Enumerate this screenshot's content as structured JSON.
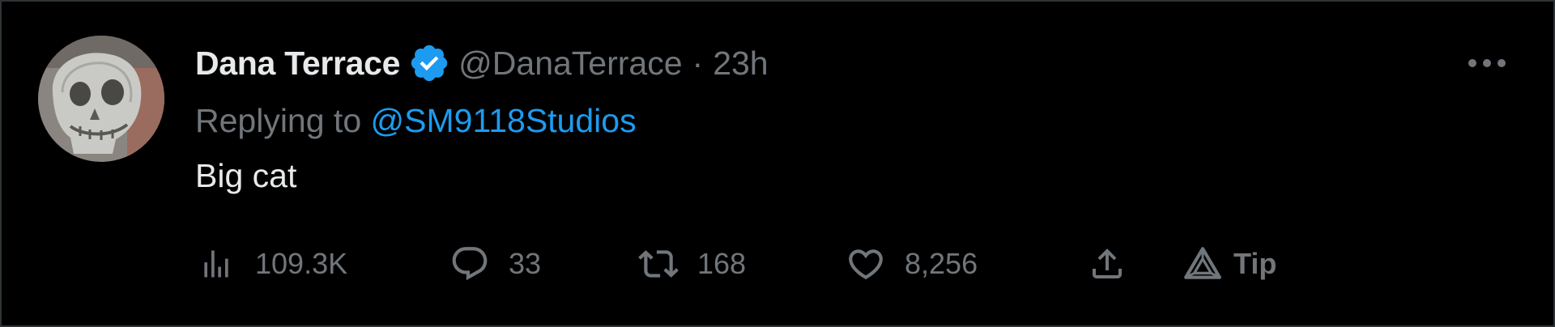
{
  "colors": {
    "background": "#000000",
    "primary_text": "#e7e9ea",
    "secondary_text": "#71767b",
    "accent": "#1d9bf0",
    "border": "#2f3336"
  },
  "tweet": {
    "author": {
      "display_name": "Dana Terrace",
      "handle": "@DanaTerrace",
      "verified_icon": "verified-badge-icon",
      "avatar": "skull-drawing-avatar"
    },
    "separator": "·",
    "time": "23h",
    "more_icon": "more-horizontal-icon",
    "replying_prefix": "Replying to",
    "replying_to": "@SM9118Studios",
    "text": "Big cat",
    "actions": {
      "views": {
        "icon": "analytics-bars-icon",
        "count": "109.3K"
      },
      "replies": {
        "icon": "reply-bubble-icon",
        "count": "33"
      },
      "retweets": {
        "icon": "retweet-icon",
        "count": "168"
      },
      "likes": {
        "icon": "heart-icon",
        "count": "8,256"
      },
      "share": {
        "icon": "share-upload-icon"
      },
      "tip": {
        "icon": "tip-triangle-icon",
        "label": "Tip"
      }
    }
  }
}
